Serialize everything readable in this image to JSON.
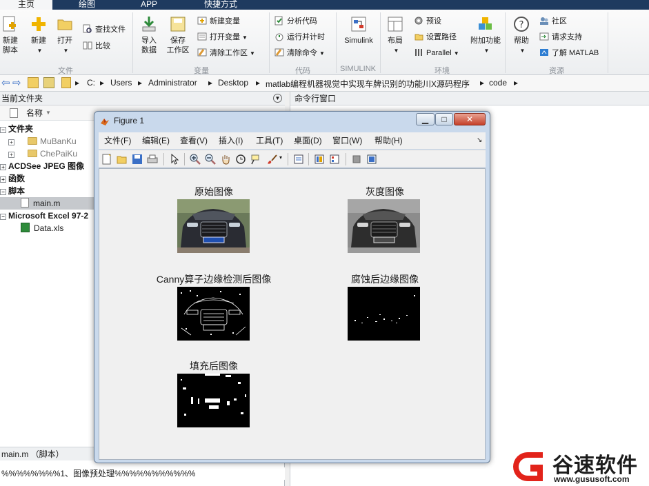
{
  "ribbon_tabs": [
    "主页",
    "绘图",
    "APP",
    "快捷方式"
  ],
  "ribbon": {
    "file_group": {
      "label": "文件",
      "new_script": "新建\n脚本",
      "new": "新建",
      "open": "打开",
      "find_files": "查找文件",
      "compare": "比较"
    },
    "variable_group": {
      "label": "变量",
      "import_data": "导入\n数据",
      "save_workspace": "保存\n工作区",
      "new_variable": "新建变量",
      "open_variable": "打开变量",
      "clear_workspace": "清除工作区"
    },
    "code_group": {
      "label": "代码",
      "analyze_code": "分析代码",
      "run_and_time": "运行并计时",
      "clear_commands": "清除命令"
    },
    "simulink_group": {
      "label": "SIMULINK",
      "simulink": "Simulink"
    },
    "environment_group": {
      "label": "环境",
      "layout": "布局",
      "preferences": "预设",
      "set_path": "设置路径",
      "parallel": "Parallel",
      "add_ons": "附加功能"
    },
    "resources_group": {
      "label": "资源",
      "help": "帮助",
      "community": "社区",
      "request_support": "请求支持",
      "learn_matlab": "了解 MATLAB"
    }
  },
  "address_bar": {
    "path": [
      "C:",
      "Users",
      "Administrator",
      "Desktop",
      "matlab编程机器视觉中实现车牌识别的功能川X源码程序",
      "code"
    ]
  },
  "current_folder": {
    "title": "当前文件夹",
    "column_name": "名称",
    "rows": [
      {
        "label": "文件夹",
        "bold": true
      },
      {
        "label": "MuBanKu",
        "bold": false
      },
      {
        "label": "ChePaiKu",
        "bold": false
      },
      {
        "label": "ACDSee JPEG 图像",
        "bold": true
      },
      {
        "label": "函数",
        "bold": true
      },
      {
        "label": "脚本",
        "bold": true
      },
      {
        "label": "main.m",
        "bold": false
      },
      {
        "label": "Microsoft Excel 97-2",
        "bold": true
      },
      {
        "label": "Data.xls",
        "bold": false
      }
    ],
    "status": "main.m （脚本）",
    "editor_line": "%%%%%%%%1、图像预处理%%%%%%%%%%%"
  },
  "command_window": {
    "title": "命令行窗口"
  },
  "figure": {
    "title": "Figure 1",
    "menus": [
      "文件(F)",
      "编辑(E)",
      "查看(V)",
      "插入(I)",
      "工具(T)",
      "桌面(D)",
      "窗口(W)",
      "帮助(H)"
    ],
    "axes_titles": [
      "原始图像",
      "灰度图像",
      "Canny算子边缘检测后图像",
      "腐蚀后边缘图像",
      "填充后图像"
    ]
  },
  "watermark": {
    "name": "谷速软件",
    "url": "www.gususoft.com",
    "color": "#e2231a"
  }
}
